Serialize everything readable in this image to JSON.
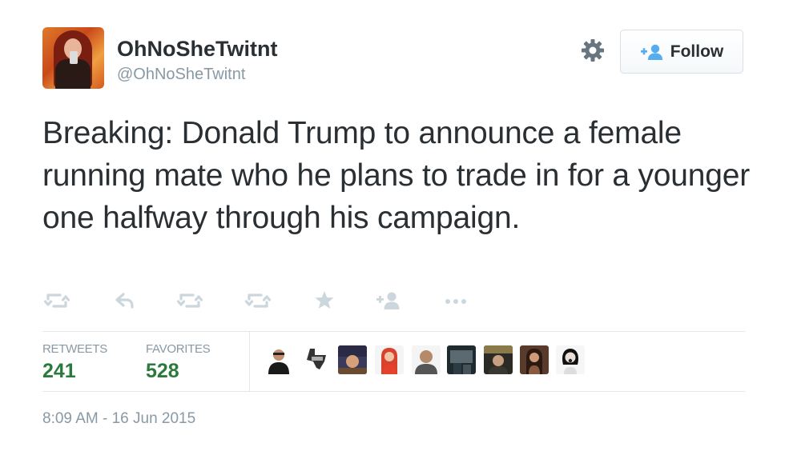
{
  "user": {
    "display_name": "OhNoSheTwitnt",
    "handle": "@OhNoSheTwitnt"
  },
  "follow_button": {
    "label": "Follow",
    "icon": "add-user-icon"
  },
  "settings": {
    "icon": "gear-icon"
  },
  "tweet": {
    "text": "Breaking: Donald Trump to announce a female running mate who he plans to trade in for a younger one halfway through his campaign."
  },
  "actions": [
    {
      "name": "retweet-icon"
    },
    {
      "name": "reply-icon"
    },
    {
      "name": "retweet-icon"
    },
    {
      "name": "retweet-icon"
    },
    {
      "name": "star-icon"
    },
    {
      "name": "add-user-icon"
    },
    {
      "name": "more-icon"
    }
  ],
  "stats": {
    "retweets_label": "RETWEETS",
    "retweets_count": "241",
    "favorites_label": "FAVORITES",
    "favorites_count": "528"
  },
  "favoriters_count": 9,
  "timestamp": "8:09 AM - 16 Jun 2015",
  "colors": {
    "text": "#292f33",
    "muted": "#8899a6",
    "stat_value": "#2b7a3d",
    "link_blue": "#55acee",
    "divider": "#e1e8ed"
  }
}
